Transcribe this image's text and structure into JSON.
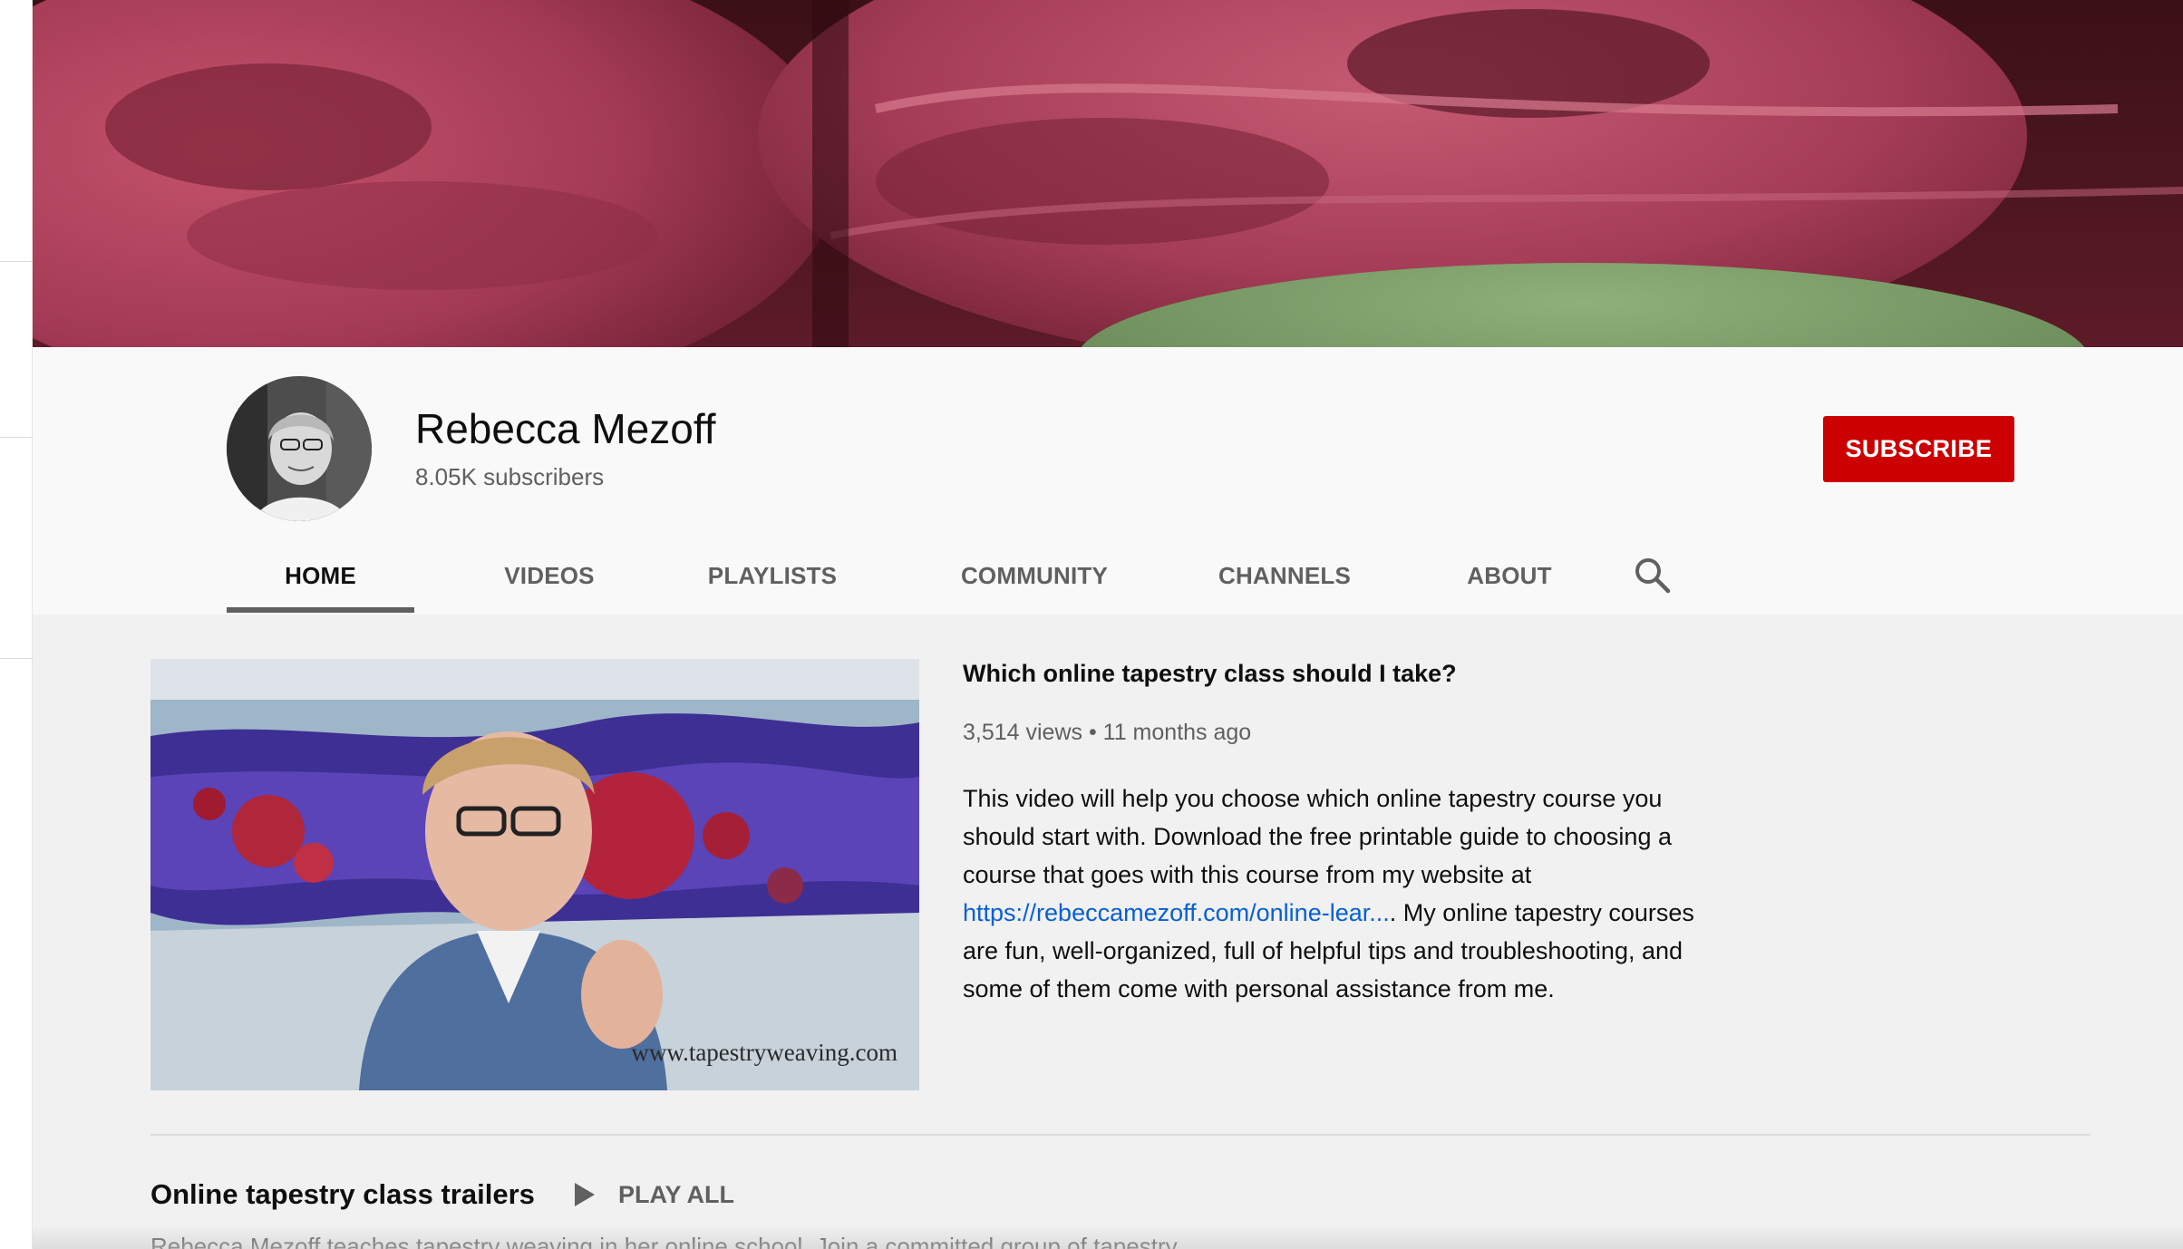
{
  "channel": {
    "name": "Rebecca Mezoff",
    "subscribers": "8.05K subscribers",
    "subscribe_label": "SUBSCRIBE"
  },
  "tabs": [
    {
      "label": "HOME",
      "active": true
    },
    {
      "label": "VIDEOS",
      "active": false
    },
    {
      "label": "PLAYLISTS",
      "active": false
    },
    {
      "label": "COMMUNITY",
      "active": false
    },
    {
      "label": "CHANNELS",
      "active": false
    },
    {
      "label": "ABOUT",
      "active": false
    }
  ],
  "tab_search_icon": "search-icon",
  "featured": {
    "title": "Which online tapestry class should I take?",
    "meta": "3,514 views • 11 months ago",
    "watermark": "www.tapestryweaving.com",
    "desc_part1": "This video will help you choose which online tapestry course you should start with. Download the free printable guide to choosing a course that goes with this course from my website at ",
    "desc_link": "https://rebeccamezoff.com/online-lear...",
    "desc_part2": ". My online tapestry courses are fun, well-organized, full of helpful tips and troubleshooting, and some of them come with personal assistance from me."
  },
  "shelf": {
    "title": "Online tapestry class trailers",
    "play_all": "PLAY ALL",
    "description": "Rebecca Mezoff teaches tapestry weaving in her online school.  Join a committed group of tapestry"
  },
  "colors": {
    "subscribe": "#cc0000",
    "link": "#065fd4",
    "muted_text": "#606060",
    "header_bg": "#f9f9f9",
    "content_bg": "#f1f1f1"
  }
}
